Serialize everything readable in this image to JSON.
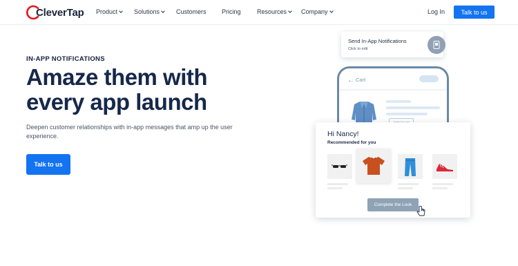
{
  "brand": {
    "name": "CleverTap",
    "accent": "#e4161c",
    "primary": "#1373f1"
  },
  "nav": {
    "items": [
      {
        "label": "Product",
        "has_menu": true
      },
      {
        "label": "Solutions",
        "has_menu": true
      },
      {
        "label": "Customers",
        "has_menu": false
      },
      {
        "label": "Pricing",
        "has_menu": false
      },
      {
        "label": "Resources",
        "has_menu": true
      },
      {
        "label": "Company",
        "has_menu": true
      }
    ],
    "login": "Log In",
    "cta": "Talk to us"
  },
  "hero": {
    "eyebrow": "IN-APP NOTIFICATIONS",
    "headline": "Amaze them with every app launch",
    "subtext": "Deepen customer relationships with in-app messages that amp up the user experience.",
    "cta": "Talk to us"
  },
  "illustration": {
    "notification": {
      "title": "Send In-App Notifications",
      "subtitle": "Click to edit"
    },
    "phone": {
      "title": "Cart",
      "added_label": "Added to cart"
    },
    "card": {
      "greeting": "Hi Nancy!",
      "subtitle": "Recommended for you",
      "products": [
        "sunglasses",
        "t-shirt",
        "jeans",
        "sneakers"
      ],
      "cta": "Complete the Look"
    }
  }
}
